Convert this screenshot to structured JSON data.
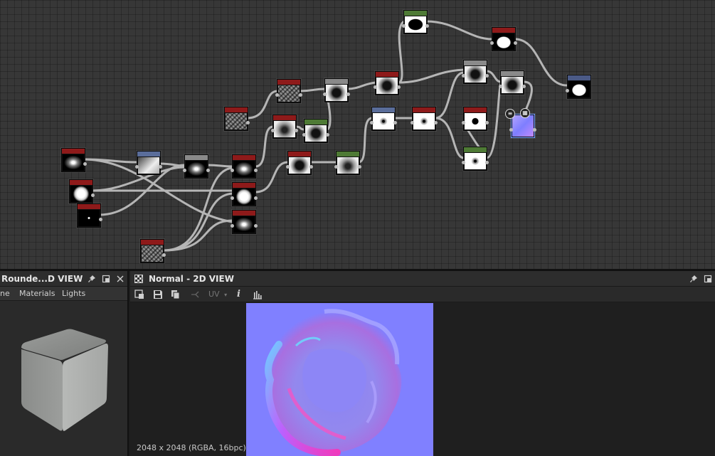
{
  "graph": {
    "nodes": [
      {
        "id": "n1",
        "name": "node-output-mask",
        "header": "hdr-green",
        "thumb": "t-blackblob"
      },
      {
        "id": "n2",
        "name": "node-levels-white-mask",
        "header": "hdr-red",
        "thumb": "t-whiteblob"
      },
      {
        "id": "n3",
        "name": "node-output-final",
        "header": "hdr-slate",
        "thumb": "t-whiteblob"
      }
    ],
    "float_buttons": [
      "document-icon",
      "checker-icon"
    ]
  },
  "panel3d": {
    "title": "Rounde...D VIEW",
    "menu": [
      "ne",
      "Materials",
      "Lights"
    ]
  },
  "panel2d": {
    "title": "Normal - 2D VIEW",
    "toolbar": {
      "uv_label": "UV",
      "info_label": "i"
    },
    "status": "2048 x 2048 (RGBA, 16bpc)"
  },
  "colors": {
    "graph_bg": "#373737",
    "node_header_red": "#8e1a1a",
    "node_header_blue": "#5a6d9a",
    "node_header_green": "#4e7a35",
    "normal_base": "#8080ff"
  }
}
